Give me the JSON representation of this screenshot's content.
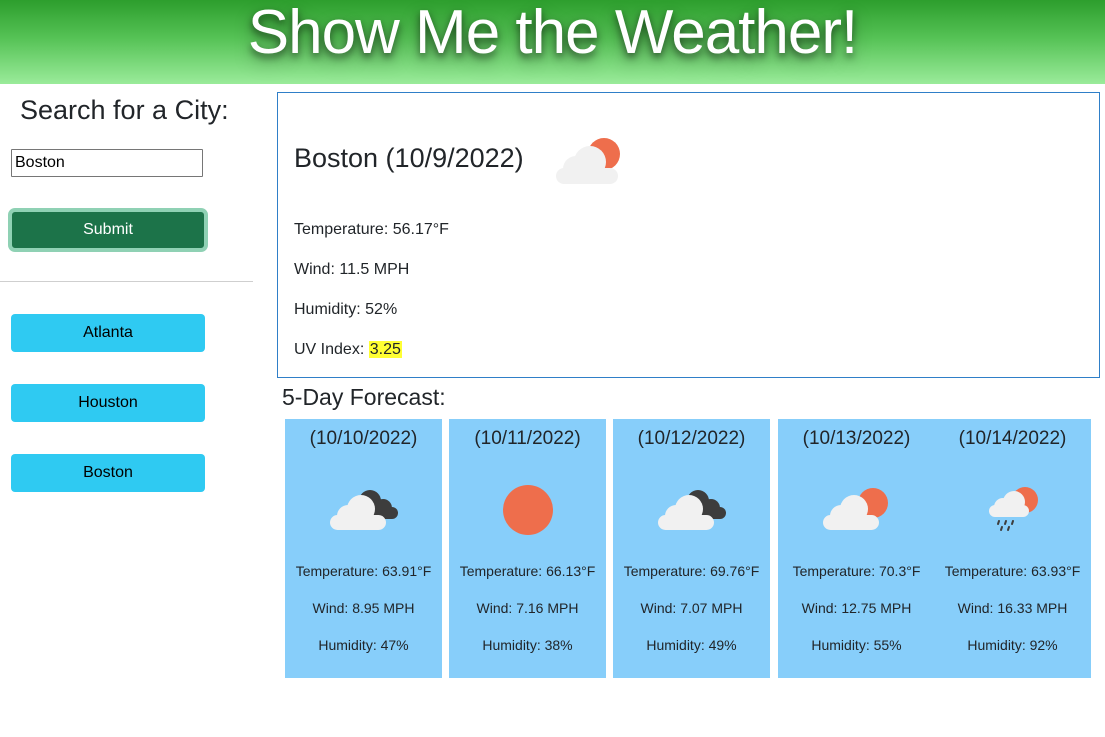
{
  "header": {
    "title": "Show Me the Weather!"
  },
  "sidebar": {
    "search_title": "Search for a City:",
    "search_value": "Boston",
    "submit_label": "Submit",
    "history": [
      {
        "label": "Atlanta"
      },
      {
        "label": "Houston"
      },
      {
        "label": "Boston"
      }
    ]
  },
  "current": {
    "title": "Boston (10/9/2022)",
    "icon": "partly-cloudy-icon",
    "temp_label": "Temperature:",
    "temp_value": "56.17°F",
    "wind_label": "Wind:",
    "wind_value": "11.5 MPH",
    "humidity_label": "Humidity:",
    "humidity_value": "52%",
    "uv_label": "UV Index:",
    "uv_value": "3.25",
    "uv_color": "#ffff33"
  },
  "forecast": {
    "title": "5-Day Forecast:",
    "card_color": "#87cefa",
    "days": [
      {
        "date": "(10/10/2022)",
        "icon": "broken-clouds-icon",
        "temp": "Temperature: 63.91°F",
        "wind": "Wind: 8.95 MPH",
        "humidity": "Humidity: 47%"
      },
      {
        "date": "(10/11/2022)",
        "icon": "clear-sun-icon",
        "temp": "Temperature: 66.13°F",
        "wind": "Wind: 7.16 MPH",
        "humidity": "Humidity: 38%"
      },
      {
        "date": "(10/12/2022)",
        "icon": "broken-clouds-icon",
        "temp": "Temperature: 69.76°F",
        "wind": "Wind: 7.07 MPH",
        "humidity": "Humidity: 49%"
      },
      {
        "date": "(10/13/2022)",
        "icon": "partly-cloudy-icon",
        "temp": "Temperature: 70.3°F",
        "wind": "Wind: 12.75 MPH",
        "humidity": "Humidity: 55%"
      },
      {
        "date": "(10/14/2022)",
        "icon": "rain-sun-icon",
        "temp": "Temperature: 63.93°F",
        "wind": "Wind: 16.33 MPH",
        "humidity": "Humidity: 92%"
      }
    ]
  }
}
